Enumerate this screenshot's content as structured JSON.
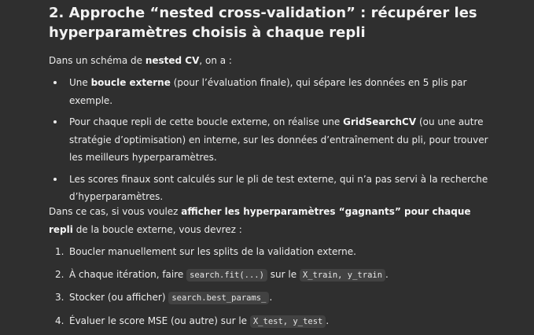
{
  "heading": "2. Approche “nested cross-validation” : récupérer les hyperparamètres choisis à chaque repli",
  "intro": {
    "prefix": "Dans un schéma de ",
    "bold": "nested CV",
    "suffix": ", on a :"
  },
  "bullets": [
    {
      "prefix": "Une ",
      "bold": "boucle externe",
      "suffix": " (pour l’évaluation finale), qui sépare les données en 5 plis par exemple."
    },
    {
      "prefix": "Pour chaque repli de cette boucle externe, on réalise une ",
      "bold": "GridSearchCV",
      "suffix": " (ou une autre stratégie d’optimisation) en interne, sur les données d’entraînement du pli, pour trouver les meilleurs hyperparamètres."
    },
    {
      "text": "Les scores finaux sont calculés sur le pli de test externe, qui n’a pas servi à la recherche d’hyperparamètres."
    }
  ],
  "para2": {
    "prefix": "Dans ce cas, si vous voulez ",
    "bold": "afficher les hyperparamètres “gagnants” pour chaque repli",
    "suffix": " de la boucle externe, vous devrez :"
  },
  "steps": [
    {
      "num": "1.",
      "text": "Boucler manuellement sur les splits de la validation externe."
    },
    {
      "num": "2.",
      "prefix": "À chaque itération, faire ",
      "code1": "search.fit(...)",
      "mid": " sur le ",
      "code2": "X_train, y_train",
      "suffix": "."
    },
    {
      "num": "3.",
      "prefix": "Stocker (ou afficher) ",
      "code1": "search.best_params_",
      "suffix": "."
    },
    {
      "num": "4.",
      "prefix": "Évaluer le score MSE (ou autre) sur le ",
      "code1": "X_test, y_test",
      "suffix": "."
    }
  ]
}
